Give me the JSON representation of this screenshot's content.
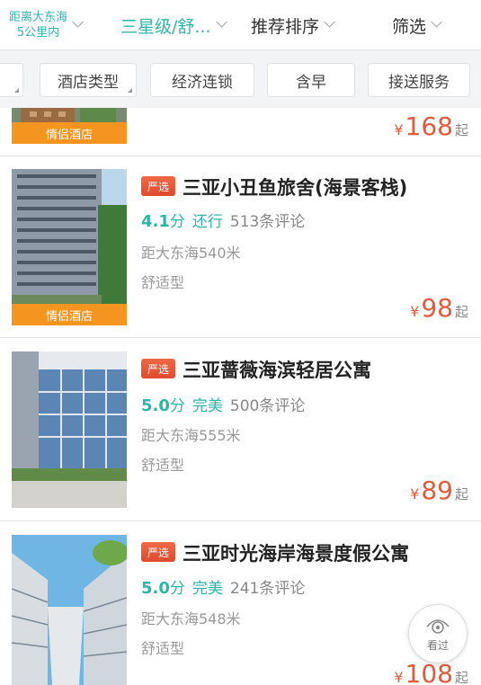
{
  "topbar": {
    "distance_line1": "距离大东海",
    "distance_line2": "5公里内",
    "star": "三星级/舒...",
    "sort": "推荐排序",
    "filter": "筛选"
  },
  "chips": [
    "酒店类型",
    "经济连锁",
    "含早",
    "接送服务"
  ],
  "hotels": [
    {
      "tag": "情侣酒店",
      "price_prefix": "¥",
      "price": "168",
      "price_suffix": "起"
    },
    {
      "badge": "严选",
      "name": "三亚小丑鱼旅舍(海景客栈)",
      "score": "4.1",
      "score_unit": "分",
      "level": "还行",
      "reviews": "513条评论",
      "distance": "距大东海540米",
      "type": "舒适型",
      "tag": "情侣酒店",
      "price_prefix": "¥",
      "price": "98",
      "price_suffix": "起"
    },
    {
      "badge": "严选",
      "name": "三亚蔷薇海滨轻居公寓",
      "score": "5.0",
      "score_unit": "分",
      "level": "完美",
      "reviews": "500条评论",
      "distance": "距大东海555米",
      "type": "舒适型",
      "price_prefix": "¥",
      "price": "89",
      "price_suffix": "起"
    },
    {
      "badge": "严选",
      "name": "三亚时光海岸海景度假公寓",
      "score": "5.0",
      "score_unit": "分",
      "level": "完美",
      "reviews": "241条评论",
      "distance": "距大东海548米",
      "type": "舒适型",
      "price_prefix": "¥",
      "price": "108",
      "price_suffix": "起"
    }
  ],
  "float_button": {
    "label": "看过",
    "icon": "eye-icon"
  },
  "colors": {
    "accent": "#2fb5a8",
    "price": "#e35a3c",
    "tag": "#f4951f"
  }
}
